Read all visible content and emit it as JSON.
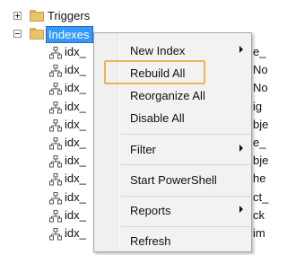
{
  "tree": {
    "triggers_label": "Triggers",
    "indexes_label": "Indexes",
    "index_item_text": "idx_",
    "cut_fragments": [
      "e_",
      "No",
      "No",
      "ig",
      "bje",
      "e_",
      "bje",
      "he",
      "ct_",
      "ck",
      "im"
    ]
  },
  "context_menu": {
    "items": [
      {
        "label": "New Index",
        "has_submenu": true
      },
      {
        "label": "Rebuild All",
        "has_submenu": false
      },
      {
        "label": "Reorganize All",
        "has_submenu": false
      },
      {
        "label": "Disable All",
        "has_submenu": false
      },
      {
        "label": "Filter",
        "has_submenu": true
      },
      {
        "label": "Start PowerShell",
        "has_submenu": false
      },
      {
        "label": "Reports",
        "has_submenu": true
      },
      {
        "label": "Refresh",
        "has_submenu": false
      }
    ],
    "highlighted_item": "Rebuild All"
  },
  "colors": {
    "selection": "#3399ff",
    "highlight_box": "#eab557",
    "folder": "#e9c46a"
  }
}
